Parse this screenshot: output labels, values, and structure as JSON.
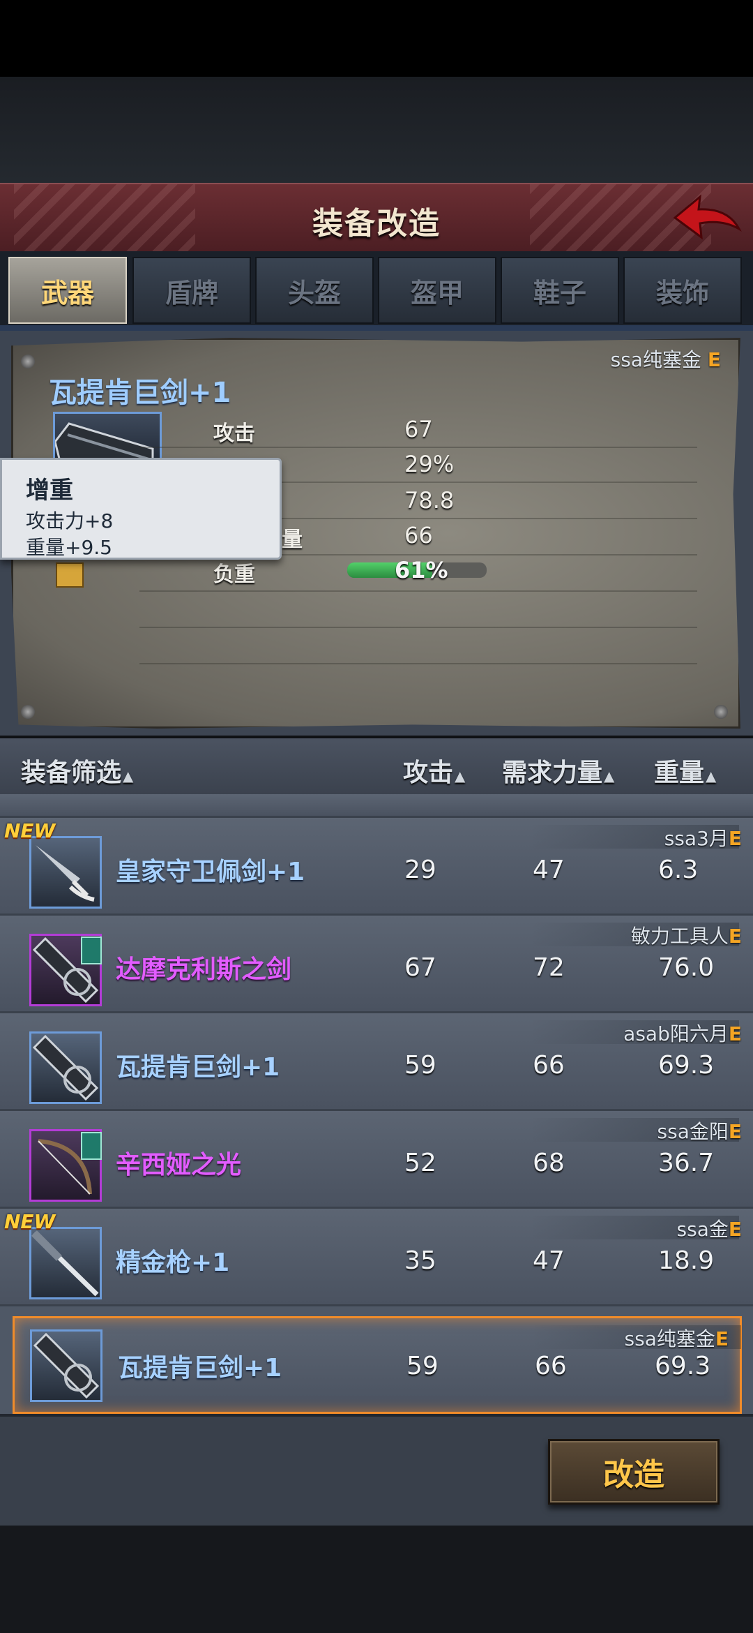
{
  "header": {
    "title": "装备改造"
  },
  "tabs": [
    {
      "label": "武器",
      "active": true
    },
    {
      "label": "盾牌",
      "active": false
    },
    {
      "label": "头盔",
      "active": false
    },
    {
      "label": "盔甲",
      "active": false
    },
    {
      "label": "鞋子",
      "active": false
    },
    {
      "label": "装饰",
      "active": false
    }
  ],
  "detail": {
    "owner": "ssa纯塞金",
    "grade": "E",
    "name": "瓦提肯巨剑+1",
    "stats": [
      {
        "label": "攻击",
        "value": "67"
      },
      {
        "label": "",
        "value": "29%"
      },
      {
        "label": "",
        "value": "78.8"
      },
      {
        "label": "量",
        "value": "66"
      },
      {
        "label": "负重",
        "value": "61%"
      }
    ],
    "load_percent": 61
  },
  "tooltip": {
    "title": "增重",
    "line1": "攻击力+8",
    "line2": "重量+9.5"
  },
  "list_header": {
    "filter": "装备筛选",
    "attack": "攻击",
    "str_req": "需求力量",
    "weight": "重量",
    "sort_glyph": "▲"
  },
  "items": [
    {
      "new": "NEW",
      "name": "皇家守卫佩剑+1",
      "owner": "ssa3月",
      "grade": "E",
      "attack": "29",
      "str": "47",
      "weight": "6.3",
      "rarity": "blue",
      "selected": false
    },
    {
      "new": "",
      "name": "达摩克利斯之剑",
      "owner": "敏力工具人",
      "grade": "E",
      "attack": "67",
      "str": "72",
      "weight": "76.0",
      "rarity": "purple",
      "selected": false
    },
    {
      "new": "",
      "name": "瓦提肯巨剑+1",
      "owner": "asab阳六月",
      "grade": "E",
      "attack": "59",
      "str": "66",
      "weight": "69.3",
      "rarity": "blue",
      "selected": false
    },
    {
      "new": "",
      "name": "辛西娅之光",
      "owner": "ssa金阳",
      "grade": "E",
      "attack": "52",
      "str": "68",
      "weight": "36.7",
      "rarity": "purple",
      "selected": false
    },
    {
      "new": "NEW",
      "name": "精金枪+1",
      "owner": "ssa金",
      "grade": "E",
      "attack": "35",
      "str": "47",
      "weight": "18.9",
      "rarity": "blue",
      "selected": false
    },
    {
      "new": "",
      "name": "瓦提肯巨剑+1",
      "owner": "ssa纯塞金",
      "grade": "E",
      "attack": "59",
      "str": "66",
      "weight": "69.3",
      "rarity": "blue",
      "selected": true
    }
  ],
  "actions": {
    "refit": "改造"
  },
  "colors": {
    "accent": "#f5a524",
    "blue_name": "#a7d1ff",
    "purple_name": "#e25cff",
    "selected_border": "#f08c2a"
  }
}
